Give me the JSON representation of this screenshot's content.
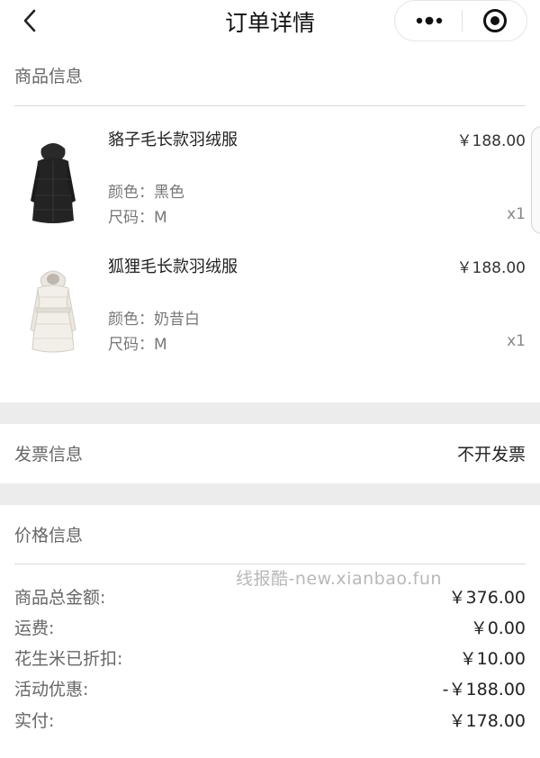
{
  "header": {
    "title": "订单详情"
  },
  "goods_section": {
    "title": "商品信息",
    "items": [
      {
        "name": "貉子毛长款羽绒服",
        "price": "￥188.00",
        "color_label": "颜色：",
        "color_value": "黑色",
        "size_label": "尺码：",
        "size_value": "M",
        "qty": "x1",
        "image": "black-down-coat-image"
      },
      {
        "name": "狐狸毛长款羽绒服",
        "price": "￥188.00",
        "color_label": "颜色：",
        "color_value": "奶昔白",
        "size_label": "尺码：",
        "size_value": "M",
        "qty": "x1",
        "image": "white-down-coat-image"
      }
    ]
  },
  "invoice_section": {
    "title": "发票信息",
    "value": "不开发票"
  },
  "price_section": {
    "title": "价格信息",
    "rows": [
      {
        "label": "商品总金额:",
        "value": "￥376.00"
      },
      {
        "label": "运费:",
        "value": "￥0.00"
      },
      {
        "label": "花生米已折扣:",
        "value": "￥10.00"
      },
      {
        "label": "活动优惠:",
        "value": "-￥188.00"
      },
      {
        "label": "实付:",
        "value": "￥178.00"
      }
    ]
  },
  "watermark": "线报酷-new.xianbao.fun",
  "icons": {
    "back": "back-arrow-icon",
    "more": "more-dots-icon",
    "target": "target-circle-icon"
  }
}
